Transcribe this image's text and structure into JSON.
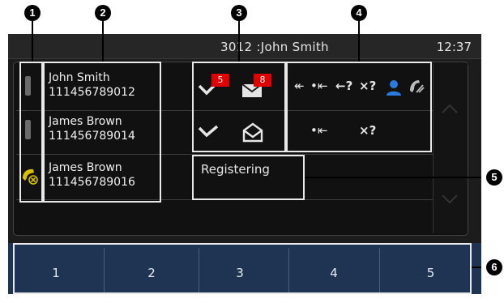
{
  "markers": [
    "1",
    "2",
    "3",
    "4",
    "5",
    "6"
  ],
  "header": {
    "title": "3012 :John  Smith",
    "time": "12:37"
  },
  "lines": [
    {
      "name": "John Smith",
      "number": "111456789012"
    },
    {
      "name": "James Brown",
      "number": "111456789014"
    },
    {
      "name": "James Brown",
      "number": "111456789016"
    }
  ],
  "badges": {
    "missed_calls": "5",
    "messages": "8"
  },
  "feature_glyphs": {
    "row1": [
      "↞",
      "•⇤",
      "←?",
      "×?"
    ],
    "row2": [
      "•⇤",
      "×?"
    ]
  },
  "status": {
    "text": "Registering"
  },
  "softkeys": [
    "1",
    "2",
    "3",
    "4",
    "5"
  ],
  "colors": {
    "badge": "#e00000",
    "softkey_bg": "#1f3352",
    "presence": "#2a7be0",
    "alert": "#d8c000"
  },
  "icons": [
    "missed-call-icon",
    "message-icon",
    "presence-icon",
    "call-forward-icon",
    "alert-handset-icon"
  ]
}
